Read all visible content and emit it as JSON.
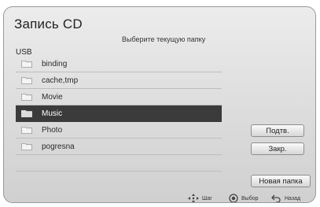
{
  "dialog": {
    "title": "Запись CD",
    "subtitle": "Выберите текущую папку",
    "drive_label": "USB"
  },
  "folders": [
    {
      "label": "binding",
      "selected": false
    },
    {
      "label": "cache,tmp",
      "selected": false
    },
    {
      "label": "Movie",
      "selected": false
    },
    {
      "label": "Music",
      "selected": true
    },
    {
      "label": "Photo",
      "selected": false
    },
    {
      "label": "pogresna",
      "selected": false
    }
  ],
  "buttons": {
    "confirm": "Подтв.",
    "close": "Закр.",
    "new_folder": "Новая папка"
  },
  "footer": {
    "step": "Шаг",
    "select": "Выбор",
    "back": "Назад"
  },
  "colors": {
    "selected_row": "#3b3b3b",
    "dialog_bg": "#dcdcdc"
  }
}
